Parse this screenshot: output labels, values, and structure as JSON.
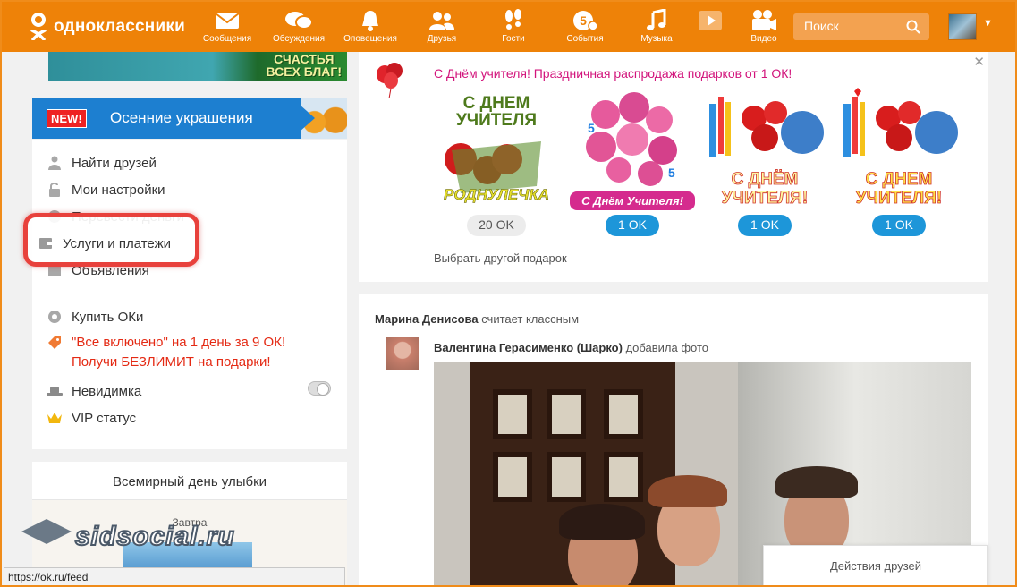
{
  "app": {
    "logo_text": "одноклассники"
  },
  "nav": {
    "items": [
      {
        "label": "Сообщения",
        "icon": "envelope-icon"
      },
      {
        "label": "Обсуждения",
        "icon": "chat-bubbles-icon"
      },
      {
        "label": "Оповещения",
        "icon": "bell-icon"
      },
      {
        "label": "Друзья",
        "icon": "friends-icon"
      },
      {
        "label": "Гости",
        "icon": "footprints-icon"
      },
      {
        "label": "События",
        "icon": "events-5-icon"
      },
      {
        "label": "Музыка",
        "icon": "music-note-icon"
      },
      {
        "label": "Видео",
        "icon": "camera-icon"
      }
    ],
    "search_placeholder": "Поиск"
  },
  "left": {
    "banner_top_text_1": "СЧАСТЬЯ",
    "banner_top_text_2": "ВСЕХ БЛАГ!",
    "promo_badge": "NEW!",
    "promo_label": "Осенние украшения",
    "menu": [
      {
        "label": "Найти друзей",
        "icon": "person-icon"
      },
      {
        "label": "Мои настройки",
        "icon": "lock-open-icon"
      },
      {
        "label": "Перевести деньги",
        "icon": "money-transfer-icon"
      },
      {
        "label": "Услуги и платежи",
        "icon": "wallet-icon"
      },
      {
        "label": "Объявления",
        "icon": "ads-icon"
      }
    ],
    "menu2": {
      "buy_ok": "Купить ОКи",
      "promo_line1": "\"Все включено\" на 1 день за 9 ОК!",
      "promo_line2": "Получи БЕЗЛИМИТ на подарки!",
      "invisible": "Невидимка",
      "vip": "VIP статус"
    },
    "smile_card": {
      "title": "Всемирный день улыбки",
      "tomorrow": "Завтра"
    }
  },
  "watermark": "sidsocial.ru",
  "statusbar": "https://ok.ru/feed",
  "gifts": {
    "headline": "С Днём учителя! Праздничная распродажа подарков от 1 ОК!",
    "items": [
      {
        "caption_top": "С ДНЕМ",
        "caption_top2": "УЧИТЕЛЯ",
        "caption_bottom": "РОДНУЛЕЧКА",
        "price": "20 OK"
      },
      {
        "caption_top": "",
        "caption_top2": "",
        "caption_bottom": "С Днём Учителя!",
        "price": "1 OK"
      },
      {
        "caption_top": "",
        "caption_top2": "",
        "caption_bottom": "С ДНЁМ УЧИТЕЛЯ!",
        "price": "1 OK"
      },
      {
        "caption_top": "",
        "caption_top2": "",
        "caption_bottom": "С ДНЕМ УЧИТЕЛЯ!",
        "price": "1 OK"
      }
    ],
    "other_link": "Выбрать другой подарок"
  },
  "feed": {
    "liker": "Марина Денисова",
    "liker_action": "считает классным",
    "author": "Валентина Герасименко (Шарко)",
    "author_action": "добавила фото"
  },
  "friends_actions": "Действия друзей",
  "colors": {
    "brand_orange": "#ee8208",
    "promo_blue": "#1d7fd0",
    "price_blue": "#1d96d9",
    "headline_pink": "#d2137b",
    "promo_red": "#e42a14",
    "highlight_red": "#e8413c"
  }
}
